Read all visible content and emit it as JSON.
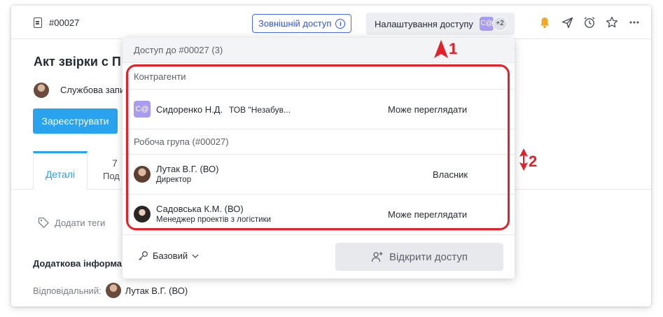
{
  "topbar": {
    "doc_number": "#00027",
    "external_access": "Зовнішній доступ",
    "access_settings": "Налаштування доступу",
    "avatar_initials": "C@",
    "extra_count": "+2",
    "icons": [
      "bell-icon",
      "send-icon",
      "alarm-clock-icon",
      "star-icon",
      "more-icon"
    ],
    "bell_color": "#f5a623"
  },
  "page": {
    "title": "Акт звірки с П",
    "memo_type": "Службова запи",
    "register_button": "Зареєструвати",
    "tabs": {
      "details": "Деталі",
      "sub_count": "7",
      "sub_label": "Под"
    },
    "add_tags": "Додати теги",
    "additional_info": "Додаткова інформа",
    "responsible_label": "Відповідальний:",
    "responsible_name": "Лутак В.Г. (ВО)"
  },
  "panel": {
    "header": "Доступ до #00027 (3)",
    "counterparties_label": "Контрагенти",
    "counterparty": {
      "initials": "C@",
      "name": "Сидоренко Н.Д.",
      "org": "ТОВ \"Незабув...",
      "permission": "Може переглядати"
    },
    "workgroup_label": "Робоча група (#00027)",
    "members": [
      {
        "name": "Лутак В.Г. (ВО)",
        "role": "Директор",
        "permission": "Власник"
      },
      {
        "name": "Садовська К.М. (ВО)",
        "role": "Менеджер проектів з логістики",
        "permission": "Може переглядати"
      }
    ],
    "role_select": "Базовий",
    "open_access_button": "Відкрити доступ"
  },
  "annotations": {
    "marker_1": "1",
    "marker_2": "2",
    "color": "#e5202b"
  }
}
